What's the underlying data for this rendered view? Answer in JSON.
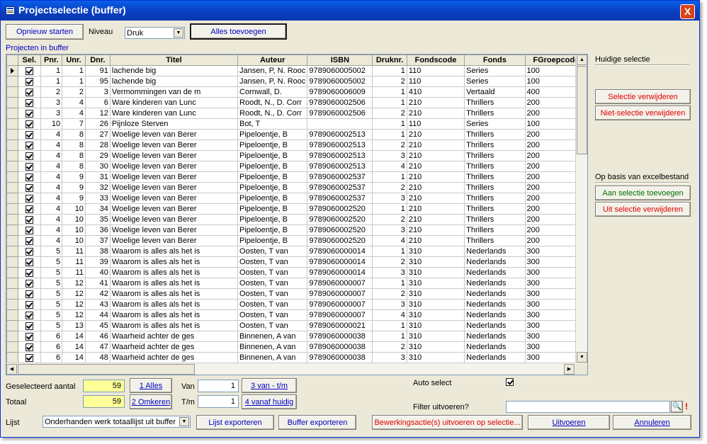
{
  "window": {
    "title": "Projectselectie (buffer)",
    "close": "X"
  },
  "toolbar": {
    "opnieuw_starten": "Opnieuw starten",
    "niveau_label": "Niveau",
    "niveau_value": "Druk",
    "alles_toevoegen": "Alles toevoegen"
  },
  "grid": {
    "caption": "Projecten in buffer",
    "columns": [
      "Sel.",
      "Pnr.",
      "Unr.",
      "Dnr.",
      "Titel",
      "Auteur",
      "ISBN",
      "Druknr.",
      "Fondscode",
      "Fonds",
      "FGroepcode"
    ],
    "rows": [
      [
        "1",
        "1",
        "91",
        "lachende big",
        "Jansen, P, N. Rooc",
        "9789060005002",
        "1",
        "110",
        "Series",
        "100"
      ],
      [
        "1",
        "1",
        "95",
        "lachende big",
        "Jansen, P, N. Rooc",
        "9789060005002",
        "2",
        "110",
        "Series",
        "100"
      ],
      [
        "2",
        "2",
        "3",
        "Vermommingen van de m",
        "Cornwall, D.",
        "9789060006009",
        "1",
        "410",
        "Vertaald",
        "400"
      ],
      [
        "3",
        "4",
        "6",
        "Ware kinderen van Lunc",
        "Roodt, N., D. Corr",
        "9789060002506",
        "1",
        "210",
        "Thrillers",
        "200"
      ],
      [
        "3",
        "4",
        "12",
        "Ware kinderen van Lunc",
        "Roodt, N., D. Corr",
        "9789060002506",
        "2",
        "210",
        "Thrillers",
        "200"
      ],
      [
        "10",
        "7",
        "26",
        "Pijnloze Sterven",
        "Bot, T",
        "",
        "1",
        "110",
        "Series",
        "100"
      ],
      [
        "4",
        "8",
        "27",
        "Woelige leven van Berer",
        "Pipeloentje, B",
        "9789060002513",
        "1",
        "210",
        "Thrillers",
        "200"
      ],
      [
        "4",
        "8",
        "28",
        "Woelige leven van Berer",
        "Pipeloentje, B",
        "9789060002513",
        "2",
        "210",
        "Thrillers",
        "200"
      ],
      [
        "4",
        "8",
        "29",
        "Woelige leven van Berer",
        "Pipeloentje, B",
        "9789060002513",
        "3",
        "210",
        "Thrillers",
        "200"
      ],
      [
        "4",
        "8",
        "30",
        "Woelige leven van Berer",
        "Pipeloentje, B",
        "9789060002513",
        "4",
        "210",
        "Thrillers",
        "200"
      ],
      [
        "4",
        "9",
        "31",
        "Woelige leven van Berer",
        "Pipeloentje, B",
        "9789060002537",
        "1",
        "210",
        "Thrillers",
        "200"
      ],
      [
        "4",
        "9",
        "32",
        "Woelige leven van Berer",
        "Pipeloentje, B",
        "9789060002537",
        "2",
        "210",
        "Thrillers",
        "200"
      ],
      [
        "4",
        "9",
        "33",
        "Woelige leven van Berer",
        "Pipeloentje, B",
        "9789060002537",
        "3",
        "210",
        "Thrillers",
        "200"
      ],
      [
        "4",
        "10",
        "34",
        "Woelige leven van Berer",
        "Pipeloentje, B",
        "9789060002520",
        "1",
        "210",
        "Thrillers",
        "200"
      ],
      [
        "4",
        "10",
        "35",
        "Woelige leven van Berer",
        "Pipeloentje, B",
        "9789060002520",
        "2",
        "210",
        "Thrillers",
        "200"
      ],
      [
        "4",
        "10",
        "36",
        "Woelige leven van Berer",
        "Pipeloentje, B",
        "9789060002520",
        "3",
        "210",
        "Thrillers",
        "200"
      ],
      [
        "4",
        "10",
        "37",
        "Woelige leven van Berer",
        "Pipeloentje, B",
        "9789060002520",
        "4",
        "210",
        "Thrillers",
        "200"
      ],
      [
        "5",
        "11",
        "38",
        "Waarom is alles als het is",
        "Oosten, T van",
        "9789060000014",
        "1",
        "310",
        "Nederlands",
        "300"
      ],
      [
        "5",
        "11",
        "39",
        "Waarom is alles als het is",
        "Oosten, T van",
        "9789060000014",
        "2",
        "310",
        "Nederlands",
        "300"
      ],
      [
        "5",
        "11",
        "40",
        "Waarom is alles als het is",
        "Oosten, T van",
        "9789060000014",
        "3",
        "310",
        "Nederlands",
        "300"
      ],
      [
        "5",
        "12",
        "41",
        "Waarom is alles als het is",
        "Oosten, T van",
        "9789060000007",
        "1",
        "310",
        "Nederlands",
        "300"
      ],
      [
        "5",
        "12",
        "42",
        "Waarom is alles als het is",
        "Oosten, T van",
        "9789060000007",
        "2",
        "310",
        "Nederlands",
        "300"
      ],
      [
        "5",
        "12",
        "43",
        "Waarom is alles als het is",
        "Oosten, T van",
        "9789060000007",
        "3",
        "310",
        "Nederlands",
        "300"
      ],
      [
        "5",
        "12",
        "44",
        "Waarom is alles als het is",
        "Oosten, T van",
        "9789060000007",
        "4",
        "310",
        "Nederlands",
        "300"
      ],
      [
        "5",
        "13",
        "45",
        "Waarom is alles als het is",
        "Oosten, T van",
        "9789060000021",
        "1",
        "310",
        "Nederlands",
        "300"
      ],
      [
        "6",
        "14",
        "46",
        "Waarheid achter de ges",
        "Binnenen, A van",
        "9789060000038",
        "1",
        "310",
        "Nederlands",
        "300"
      ],
      [
        "6",
        "14",
        "47",
        "Waarheid achter de ges",
        "Binnenen, A van",
        "9789060000038",
        "2",
        "310",
        "Nederlands",
        "300"
      ],
      [
        "6",
        "14",
        "48",
        "Waarheid achter de ges",
        "Binnenen, A van",
        "9789060000038",
        "3",
        "310",
        "Nederlands",
        "300"
      ]
    ]
  },
  "right_panel": {
    "huidige_selectie": "Huidige selectie",
    "selectie_verwijderen": "Selectie verwijderen",
    "niet_selectie_verwijderen": "Niet-selectie verwijderen",
    "op_basis": "Op basis van excelbestand",
    "aan_selectie_toevoegen": "Aan selectie toevoegen",
    "uit_selectie_verwijderen": "Uit selectie verwijderen"
  },
  "bottom": {
    "geselecteerd_label": "Geselecteerd aantal",
    "geselecteerd_value": "59",
    "totaal_label": "Totaal",
    "totaal_value": "59",
    "alles_btn": "1 Alles",
    "omkeren_btn": "2 Omkeren",
    "van_label": "Van",
    "van_value": "1",
    "tm_label": "T/m",
    "tm_value": "1",
    "van_tm_btn": "3 van - t/m",
    "vanaf_huidig_btn": "4 vanaf huidig",
    "auto_select_label": "Auto select",
    "filter_label": "Filter uitvoeren?",
    "lijst_label": "Lijst",
    "lijst_value": "Onderhanden werk totaallijst uit buffer",
    "lijst_exporteren": "Lijst exporteren",
    "buffer_exporteren": "Buffer exporteren",
    "bewerkingsactie": "Bewerkingsactie(s) uitvoeren op selectie...",
    "uitvoeren": "Uitvoeren",
    "annuleren": "Annuleren"
  }
}
